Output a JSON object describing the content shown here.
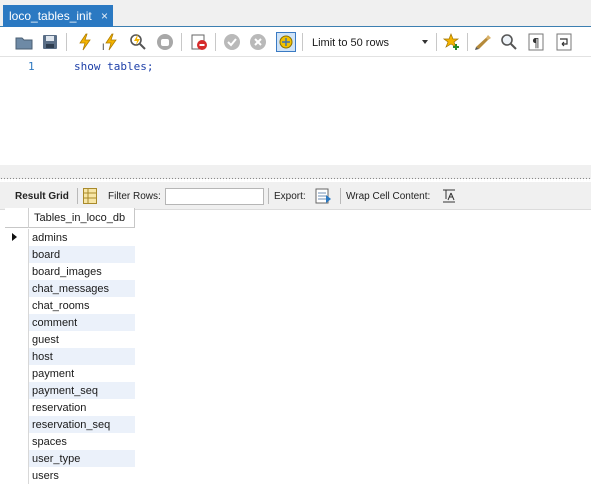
{
  "tab": {
    "title": "loco_tables_init",
    "close_glyph": "×"
  },
  "toolbar": {
    "icons": [
      "open-folder-icon",
      "save-icon",
      "execute-icon",
      "execute-statement-icon",
      "explain-icon",
      "stop-icon",
      "toggle-error-icon",
      "commit-icon",
      "rollback-icon",
      "autocommit-icon",
      "bookmark-icon",
      "beautify-icon",
      "find-icon",
      "invisible-chars-icon",
      "word-wrap-icon"
    ],
    "limit_label": "Limit to 50 rows"
  },
  "editor": {
    "line_number": "1",
    "code": "show tables;"
  },
  "result_toolbar": {
    "result_grid_label": "Result Grid",
    "filter_rows_label": "Filter Rows:",
    "filter_value": "",
    "export_label": "Export:",
    "wrap_label": "Wrap Cell Content:"
  },
  "grid": {
    "column_header": "Tables_in_loco_db",
    "rows": [
      "admins",
      "board",
      "board_images",
      "chat_messages",
      "chat_rooms",
      "comment",
      "guest",
      "host",
      "payment",
      "payment_seq",
      "reservation",
      "reservation_seq",
      "spaces",
      "user_type",
      "users"
    ]
  },
  "colors": {
    "tab_active": "#2b79c2",
    "code_keyword": "#1d3fa8",
    "alt_row": "#ebf1fa"
  }
}
